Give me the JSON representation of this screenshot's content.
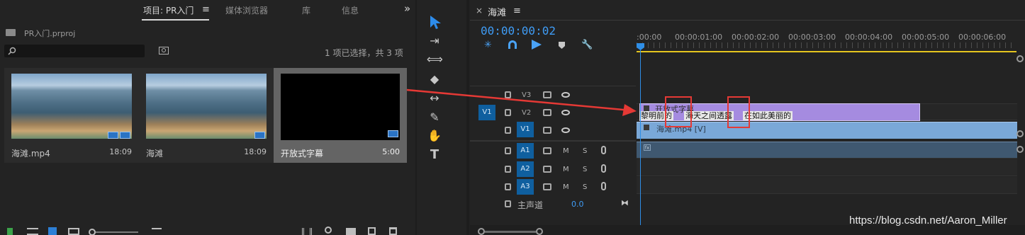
{
  "project": {
    "tabs": [
      "项目: PR入门",
      "媒体浏览器",
      "库",
      "信息"
    ],
    "menu_icon": "≡",
    "expand_icon": "»",
    "file_name": "PR入门.prproj",
    "selection_status": "1 项已选择，共 3 项",
    "items": [
      {
        "name": "海滩.mp4",
        "duration": "18:09"
      },
      {
        "name": "海滩",
        "duration": "18:09"
      },
      {
        "name": "开放式字幕",
        "duration": "5:00"
      }
    ]
  },
  "timeline": {
    "close_icon": "×",
    "sequence_name": "海滩",
    "menu_icon": "≡",
    "timecode": "00:00:00:02",
    "ruler_ticks": [
      ":00:00",
      "00:00:01:00",
      "00:00:02:00",
      "00:00:03:00",
      "00:00:04:00",
      "00:00:05:00",
      "00:00:06:00"
    ],
    "tracks": {
      "v3": "V3",
      "v2": "V2",
      "v1": "V1",
      "v1_source": "V1",
      "a1": "A1",
      "a2": "A2",
      "a3": "A3",
      "m": "M",
      "s": "S"
    },
    "master_label": "主声道",
    "master_value": "0.0",
    "clips": {
      "caption_title": "开放式字幕",
      "caption_segments": [
        "黎明前的",
        "海天之间透露",
        "在如此美丽的"
      ],
      "video_clip": "海滩.mp4 [V]",
      "audio_fx": "fx"
    }
  },
  "watermark": "https://blog.csdn.net/Aaron_Miller",
  "colors": {
    "caption_clip": "#a58be0",
    "video_clip": "#7aa8d8",
    "audio_clip": "#3f5870",
    "playhead": "#2f8ee6",
    "work_area": "#e5c51e",
    "annotation_red": "#e53935"
  }
}
